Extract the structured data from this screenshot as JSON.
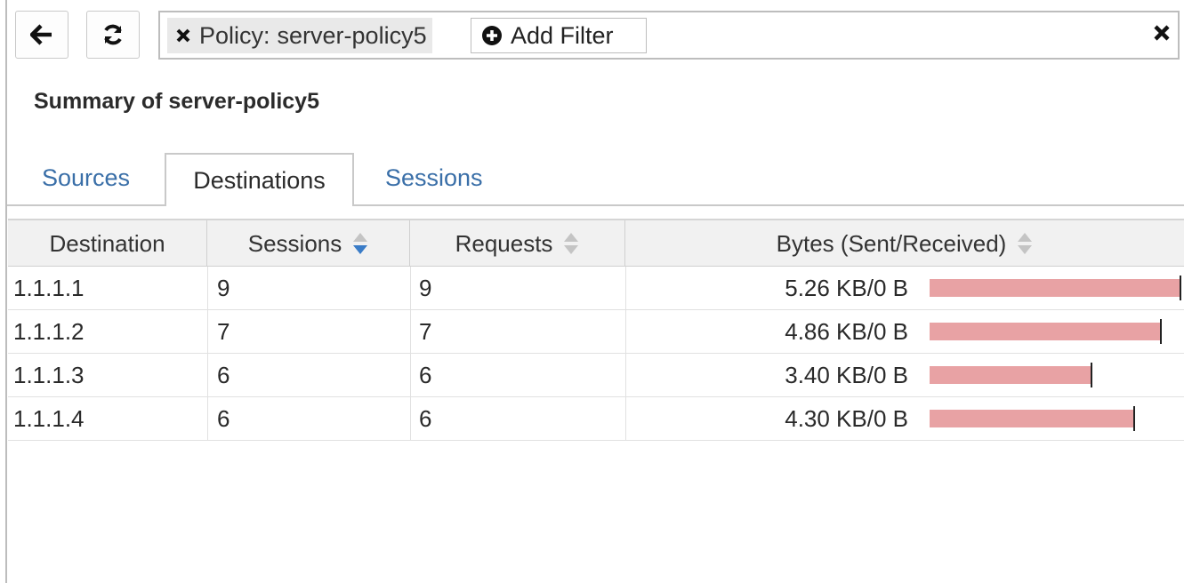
{
  "toolbar": {
    "back_icon": "arrow-left-icon",
    "refresh_icon": "refresh-icon"
  },
  "filter": {
    "chip_label": "Policy:",
    "chip_value": "server-policy5",
    "add_filter_label": "Add Filter"
  },
  "summary": {
    "title": "Summary of server-policy5"
  },
  "tabs": [
    {
      "label": "Sources",
      "active": false
    },
    {
      "label": "Destinations",
      "active": true
    },
    {
      "label": "Sessions",
      "active": false
    }
  ],
  "table": {
    "columns": {
      "destination": "Destination",
      "sessions": "Sessions",
      "requests": "Requests",
      "bytes": "Bytes (Sent/Received)"
    },
    "sorted_column": "sessions",
    "rows": [
      {
        "destination": "1.1.1.1",
        "sessions": "9",
        "requests": "9",
        "bytes": "5.26 KB/0 B",
        "bytes_kb": 5.26
      },
      {
        "destination": "1.1.1.2",
        "sessions": "7",
        "requests": "7",
        "bytes": "4.86 KB/0 B",
        "bytes_kb": 4.86
      },
      {
        "destination": "1.1.1.3",
        "sessions": "6",
        "requests": "6",
        "bytes": "3.40 KB/0 B",
        "bytes_kb": 3.4
      },
      {
        "destination": "1.1.1.4",
        "sessions": "6",
        "requests": "6",
        "bytes": "4.30 KB/0 B",
        "bytes_kb": 4.3
      }
    ]
  },
  "colors": {
    "bar": "#e8a2a4",
    "tab_link": "#3a6fa8",
    "sort_active": "#3a7cc7",
    "sort_inactive": "#c4c4c4"
  }
}
